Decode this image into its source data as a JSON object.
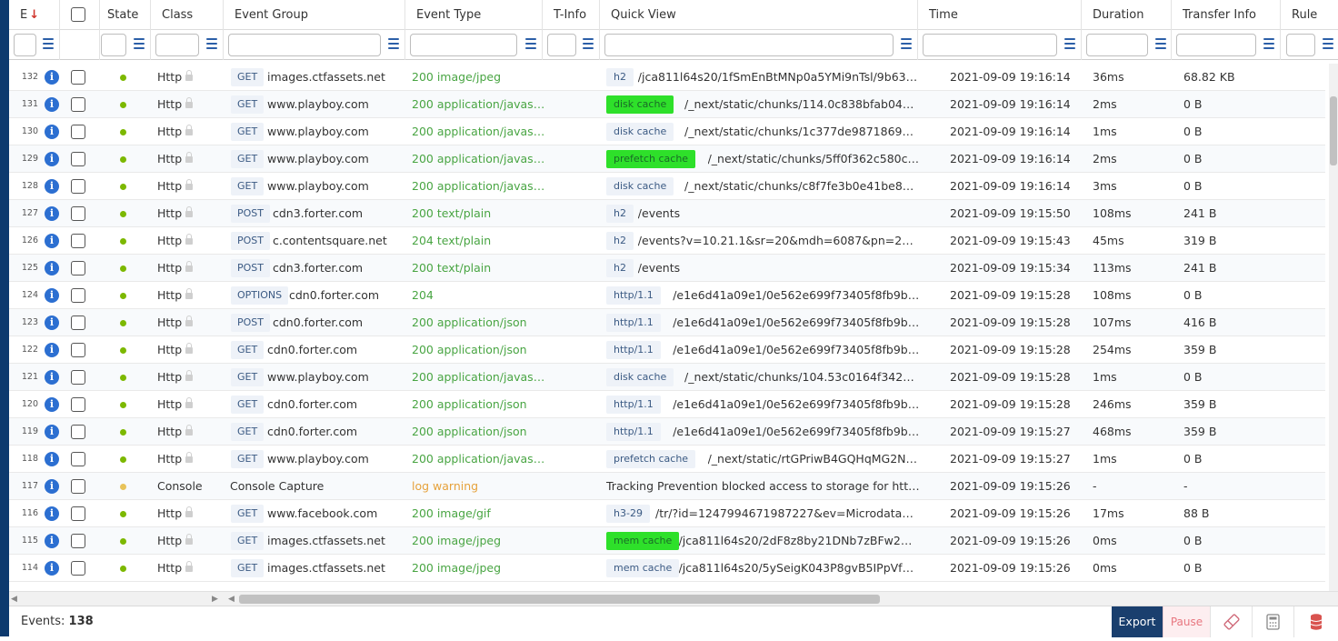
{
  "colors": {
    "accent": "#1a3f6e",
    "info_icon": "#2c6fd1",
    "status_ok": "#7cb800",
    "status_warn": "#e8c35a",
    "event_type_ok": "#49a543",
    "event_type_warn": "#e6a23c",
    "highlight": "#2ee02a",
    "pause_text": "#e87780"
  },
  "header": {
    "event_num": "E",
    "sort_icon": "arrow-down-icon",
    "state": "State",
    "class": "Class",
    "event_group": "Event Group",
    "event_type": "Event Type",
    "t_info": "T-Info",
    "quick_view": "Quick View",
    "time": "Time",
    "duration": "Duration",
    "transfer_info": "Transfer Info",
    "rule": "Rule"
  },
  "rows": [
    {
      "num": "132",
      "state": "ok",
      "cls": "Http",
      "method": "GET",
      "host": "images.ctfassets.net",
      "etype": "200 image/jpeg",
      "proto": "h2",
      "hl": false,
      "qv": "/jca811l64s20/1fSmEnBtMNp0a5YMi9nTsl/9b631437...",
      "time": "2021-09-09 19:16:14",
      "dur": "36ms",
      "xfer": "68.82 KB"
    },
    {
      "num": "131",
      "state": "ok",
      "cls": "Http",
      "method": "GET",
      "host": "www.playboy.com",
      "etype": "200 application/javasc...",
      "proto": "disk cache",
      "hl": true,
      "qv": "/_next/static/chunks/114.0c838bfab04dc0ffe...",
      "time": "2021-09-09 19:16:14",
      "dur": "2ms",
      "xfer": "0 B"
    },
    {
      "num": "130",
      "state": "ok",
      "cls": "Http",
      "method": "GET",
      "host": "www.playboy.com",
      "etype": "200 application/javasc...",
      "proto": "disk cache",
      "hl": false,
      "qv": "/_next/static/chunks/1c377de9871869784a9a...",
      "time": "2021-09-09 19:16:14",
      "dur": "1ms",
      "xfer": "0 B"
    },
    {
      "num": "129",
      "state": "ok",
      "cls": "Http",
      "method": "GET",
      "host": "www.playboy.com",
      "etype": "200 application/javasc...",
      "proto": "prefetch cache",
      "hl": true,
      "qv": "/_next/static/chunks/5ff0f362c580c6c0cf...",
      "time": "2021-09-09 19:16:14",
      "dur": "2ms",
      "xfer": "0 B"
    },
    {
      "num": "128",
      "state": "ok",
      "cls": "Http",
      "method": "GET",
      "host": "www.playboy.com",
      "etype": "200 application/javasc...",
      "proto": "disk cache",
      "hl": false,
      "qv": "/_next/static/chunks/c8f7fe3b0e41be846d56...",
      "time": "2021-09-09 19:16:14",
      "dur": "3ms",
      "xfer": "0 B"
    },
    {
      "num": "127",
      "state": "ok",
      "cls": "Http",
      "method": "POST",
      "host": "cdn3.forter.com",
      "etype": "200 text/plain",
      "proto": "h2",
      "hl": false,
      "qv": "/events",
      "time": "2021-09-09 19:15:50",
      "dur": "108ms",
      "xfer": "241 B"
    },
    {
      "num": "126",
      "state": "ok",
      "cls": "Http",
      "method": "POST",
      "host": "c.contentsquare.net",
      "etype": "204 text/plain",
      "proto": "h2",
      "hl": false,
      "qv": "/events?v=10.21.1&sr=20&mdh=6087&pn=2&uu=1fa9...",
      "time": "2021-09-09 19:15:43",
      "dur": "45ms",
      "xfer": "319 B"
    },
    {
      "num": "125",
      "state": "ok",
      "cls": "Http",
      "method": "POST",
      "host": "cdn3.forter.com",
      "etype": "200 text/plain",
      "proto": "h2",
      "hl": false,
      "qv": "/events",
      "time": "2021-09-09 19:15:34",
      "dur": "113ms",
      "xfer": "241 B"
    },
    {
      "num": "124",
      "state": "ok",
      "cls": "Http",
      "method": "OPTIONS",
      "host": "cdn0.forter.com",
      "etype": "204",
      "proto": "http/1.1",
      "hl": false,
      "qv": "/e1e6d41a09e1/0e562e699f73405f8fb9bd52ab1...",
      "time": "2021-09-09 19:15:28",
      "dur": "108ms",
      "xfer": "0 B"
    },
    {
      "num": "123",
      "state": "ok",
      "cls": "Http",
      "method": "POST",
      "host": "cdn0.forter.com",
      "etype": "200 application/json",
      "proto": "http/1.1",
      "hl": false,
      "qv": "/e1e6d41a09e1/0e562e699f73405f8fb9bd52ab1...",
      "time": "2021-09-09 19:15:28",
      "dur": "107ms",
      "xfer": "416 B"
    },
    {
      "num": "122",
      "state": "ok",
      "cls": "Http",
      "method": "GET",
      "host": "cdn0.forter.com",
      "etype": "200 application/json",
      "proto": "http/1.1",
      "hl": false,
      "qv": "/e1e6d41a09e1/0e562e699f73405f8fb9bd52ab1...",
      "time": "2021-09-09 19:15:28",
      "dur": "254ms",
      "xfer": "359 B"
    },
    {
      "num": "121",
      "state": "ok",
      "cls": "Http",
      "method": "GET",
      "host": "www.playboy.com",
      "etype": "200 application/javasc...",
      "proto": "disk cache",
      "hl": false,
      "qv": "/_next/static/chunks/104.53c0164f3420207a5...",
      "time": "2021-09-09 19:15:28",
      "dur": "1ms",
      "xfer": "0 B"
    },
    {
      "num": "120",
      "state": "ok",
      "cls": "Http",
      "method": "GET",
      "host": "cdn0.forter.com",
      "etype": "200 application/json",
      "proto": "http/1.1",
      "hl": false,
      "qv": "/e1e6d41a09e1/0e562e699f73405f8fb9bd52ab1...",
      "time": "2021-09-09 19:15:28",
      "dur": "246ms",
      "xfer": "359 B"
    },
    {
      "num": "119",
      "state": "ok",
      "cls": "Http",
      "method": "GET",
      "host": "cdn0.forter.com",
      "etype": "200 application/json",
      "proto": "http/1.1",
      "hl": false,
      "qv": "/e1e6d41a09e1/0e562e699f73405f8fb9bd52ab1...",
      "time": "2021-09-09 19:15:27",
      "dur": "468ms",
      "xfer": "359 B"
    },
    {
      "num": "118",
      "state": "ok",
      "cls": "Http",
      "method": "GET",
      "host": "www.playboy.com",
      "etype": "200 application/javasc...",
      "proto": "prefetch cache",
      "hl": false,
      "qv": "/_next/static/rtGPriwB4GQHqMG2NYejY/...",
      "time": "2021-09-09 19:15:27",
      "dur": "1ms",
      "xfer": "0 B"
    },
    {
      "num": "117",
      "state": "warn",
      "cls": "Console",
      "method": "",
      "host": "Console Capture",
      "etype": "log warning",
      "proto": "",
      "hl": false,
      "qv": "Tracking Prevention blocked access to storage for https...",
      "time": "2021-09-09 19:15:26",
      "dur": "-",
      "xfer": "-"
    },
    {
      "num": "116",
      "state": "ok",
      "cls": "Http",
      "method": "GET",
      "host": "www.facebook.com",
      "etype": "200 image/gif",
      "proto": "h3-29",
      "hl": false,
      "qv": "/tr/?id=1247994671987227&ev=Microdata&dl=htt...",
      "time": "2021-09-09 19:15:26",
      "dur": "17ms",
      "xfer": "88 B"
    },
    {
      "num": "115",
      "state": "ok",
      "cls": "Http",
      "method": "GET",
      "host": "images.ctfassets.net",
      "etype": "200 image/jpeg",
      "proto": "mem cache",
      "hl": true,
      "qv": "/jca811l64s20/2dF8z8by21DNb7zBFw2wdC...",
      "time": "2021-09-09 19:15:26",
      "dur": "0ms",
      "xfer": "0 B"
    },
    {
      "num": "114",
      "state": "ok",
      "cls": "Http",
      "method": "GET",
      "host": "images.ctfassets.net",
      "etype": "200 image/jpeg",
      "proto": "mem cache",
      "hl": false,
      "qv": "/jca811l64s20/5ySeigK043P8gvB5IPpVfp/5...",
      "time": "2021-09-09 19:15:26",
      "dur": "0ms",
      "xfer": "0 B"
    }
  ],
  "footer": {
    "events_label": "Events:",
    "events_count": "138",
    "export_label": "Export",
    "pause_label": "Pause",
    "icons": [
      "eraser-icon",
      "calculator-icon",
      "database-icon"
    ]
  }
}
